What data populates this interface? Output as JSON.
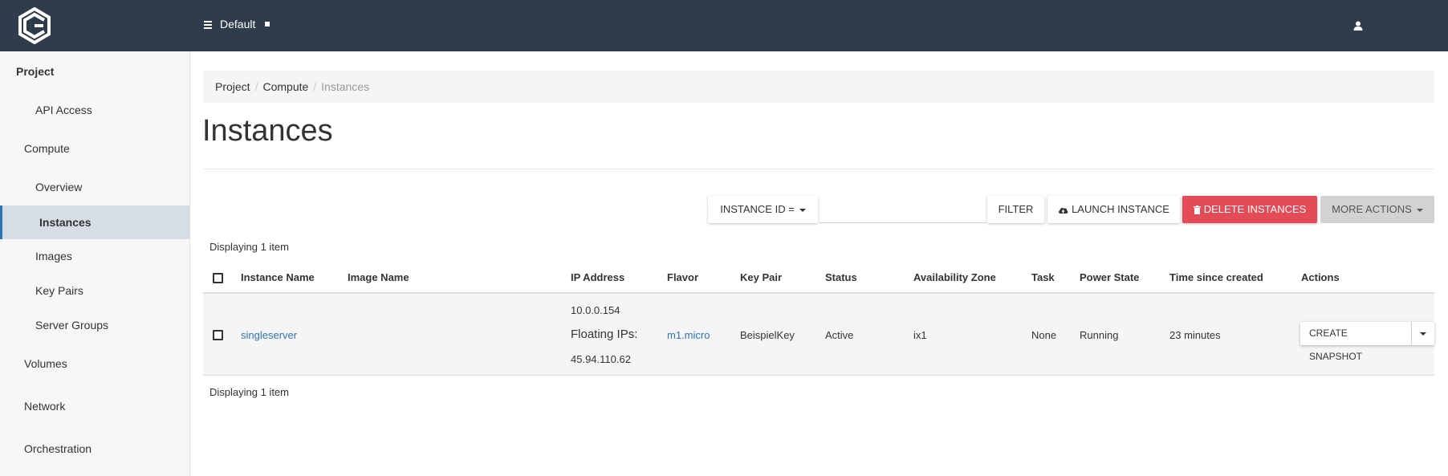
{
  "header": {
    "project_selector": "Default"
  },
  "sidebar": {
    "root": "Project",
    "items": [
      {
        "label": "API Access"
      },
      {
        "label": "Compute"
      },
      {
        "label": "Overview"
      },
      {
        "label": "Instances"
      },
      {
        "label": "Images"
      },
      {
        "label": "Key Pairs"
      },
      {
        "label": "Server Groups"
      },
      {
        "label": "Volumes"
      },
      {
        "label": "Network"
      },
      {
        "label": "Orchestration"
      }
    ]
  },
  "breadcrumb": [
    "Project",
    "Compute",
    "Instances"
  ],
  "page": {
    "title": "Instances"
  },
  "toolbar": {
    "filter_field": "Instance ID =",
    "filter_value": "",
    "filter_button": "Filter",
    "launch_button": "Launch Instance",
    "delete_button": "Delete Instances",
    "more_button": "More Actions"
  },
  "table": {
    "count_top": "Displaying 1 item",
    "count_bottom": "Displaying 1 item",
    "columns": [
      "Instance Name",
      "Image Name",
      "IP Address",
      "Flavor",
      "Key Pair",
      "Status",
      "Availability Zone",
      "Task",
      "Power State",
      "Time since created",
      "Actions"
    ],
    "rows": [
      {
        "instance_name": "singleserver",
        "image_name": "",
        "ip_address": "10.0.0.154",
        "floating_label": "Floating IPs:",
        "floating_ip": "45.94.110.62",
        "flavor": "m1.micro",
        "key_pair": "BeispielKey",
        "status": "Active",
        "availability_zone": "ix1",
        "task": "None",
        "power_state": "Running",
        "time_since_created": "23 minutes",
        "action": "Create Snapshot"
      }
    ]
  },
  "colors": {
    "topbar": "#2f3c4b",
    "link": "#2f73b6",
    "danger": "#e44b56",
    "active_nav": "#d6dde4"
  },
  "icons": [
    "cube-logo-icon",
    "list-icon",
    "user-icon",
    "cloud-upload-icon",
    "trash-icon",
    "caret-down-icon"
  ]
}
